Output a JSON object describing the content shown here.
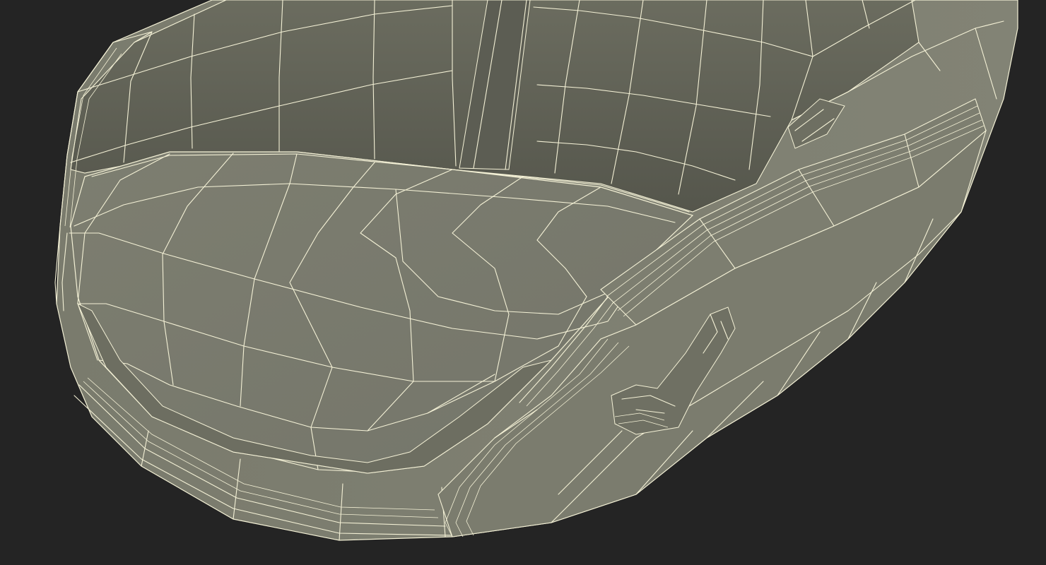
{
  "scene": {
    "subject": "seat-shell-wireframe",
    "background_color": "#242424",
    "surface_color": "#7a7b6d",
    "surface_dark_color": "#5d5e53",
    "wire_color": "#f4f1d6"
  }
}
